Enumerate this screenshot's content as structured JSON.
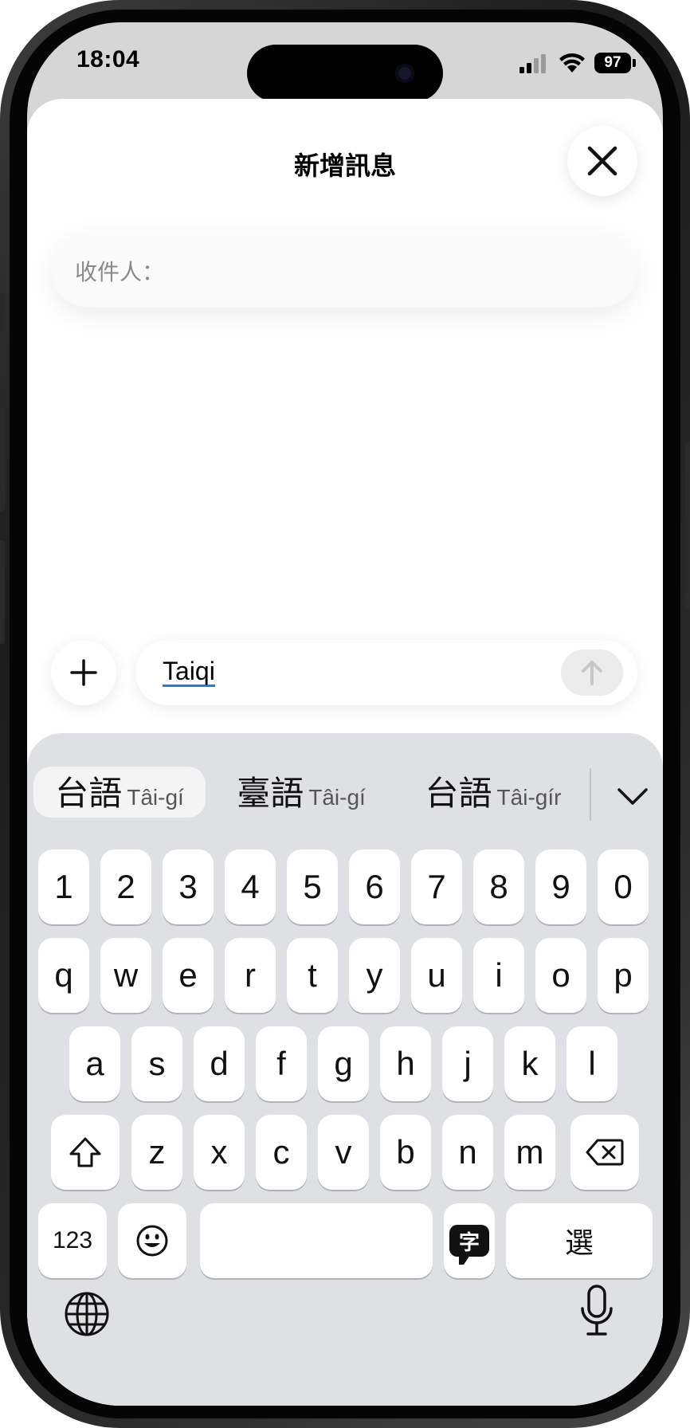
{
  "status": {
    "time": "18:04",
    "battery": "97"
  },
  "sheet": {
    "title": "新增訊息",
    "recipient_label": "收件人："
  },
  "compose": {
    "text": "Taiqi"
  },
  "candidates": [
    {
      "hanzi": "台語",
      "roman": "Tâi-gí"
    },
    {
      "hanzi": "臺語",
      "roman": "Tâi-gí"
    },
    {
      "hanzi": "台語",
      "roman": "Tâi-gír"
    }
  ],
  "keyboard": {
    "row1": [
      "1",
      "2",
      "3",
      "4",
      "5",
      "6",
      "7",
      "8",
      "9",
      "0"
    ],
    "row2": [
      "q",
      "w",
      "e",
      "r",
      "t",
      "y",
      "u",
      "i",
      "o",
      "p"
    ],
    "row3": [
      "a",
      "s",
      "d",
      "f",
      "g",
      "h",
      "j",
      "k",
      "l"
    ],
    "row4": [
      "z",
      "x",
      "c",
      "v",
      "b",
      "n",
      "m"
    ],
    "numbers_label": "123",
    "ime_label": "字",
    "select_label": "選"
  },
  "icons": {
    "close": "close-icon",
    "plus": "plus-icon",
    "send": "arrow-up-icon",
    "collapse": "chevron-down-icon",
    "shift": "shift-icon",
    "delete": "delete-icon",
    "emoji": "emoji-icon",
    "globe": "globe-icon",
    "mic": "microphone-icon"
  },
  "colors": {
    "accent": "#1e7cf0",
    "keyboard_bg": "#dfe0e3",
    "key_bg": "#ffffff"
  }
}
